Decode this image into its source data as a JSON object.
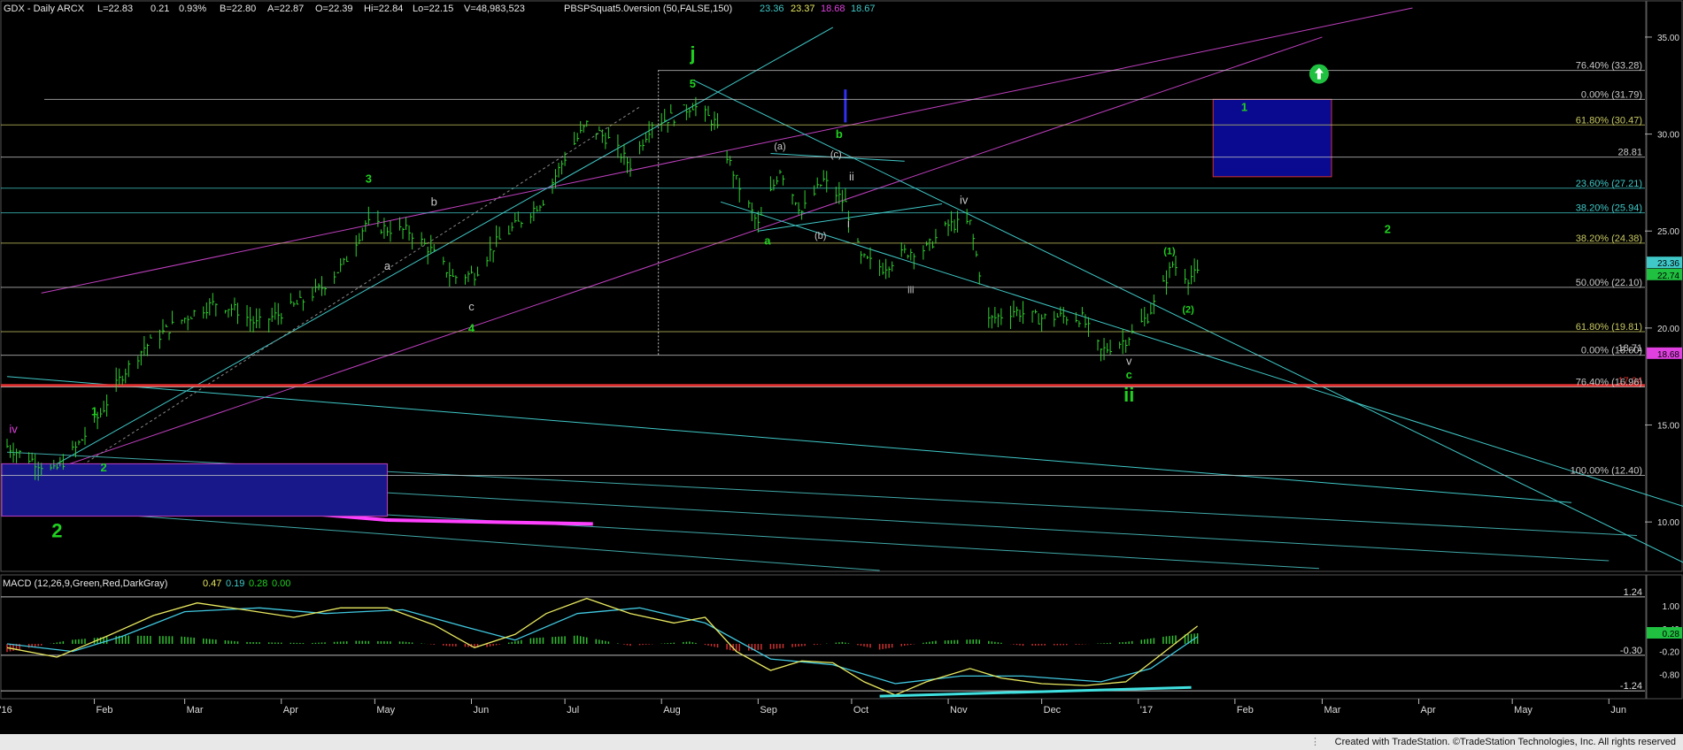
{
  "header": {
    "symbol": "GDX - Daily  ARCX",
    "last": "L=22.83",
    "change": "0.21",
    "change_pct": "0.93%",
    "bid": "B=22.80",
    "ask": "A=22.87",
    "open": "O=22.39",
    "high": "Hi=22.84",
    "low": "Lo=22.15",
    "volume": "V=48,983,523",
    "study": "PBSPSquat5.0version (50,FALSE,150)",
    "study_values": [
      "23.36",
      "23.37",
      "18.68",
      "18.67"
    ],
    "study_colors": [
      "#40c8c8",
      "#e8e860",
      "#e040e0",
      "#40c8c8"
    ]
  },
  "chart_data": {
    "type": "candlestick",
    "x_ticks": [
      "'16",
      "Feb",
      "Mar",
      "Apr",
      "May",
      "Jun",
      "Jul",
      "Aug",
      "Sep",
      "Oct",
      "Nov",
      "Dec",
      "'17",
      "Feb",
      "Mar",
      "Apr",
      "May",
      "Jun"
    ],
    "y_ticks": [
      "35.00",
      "30.00",
      "25.00",
      "20.00",
      "15.00",
      "10.00"
    ],
    "ylim": [
      7.5,
      36
    ],
    "price_path": [
      [
        "2016-01-04",
        13.9
      ],
      [
        "2016-01-12",
        13.2
      ],
      [
        "2016-01-19",
        12.6
      ],
      [
        "2016-01-26",
        13.8
      ],
      [
        "2016-02-03",
        15.6
      ],
      [
        "2016-02-10",
        17.6
      ],
      [
        "2016-02-17",
        19.0
      ],
      [
        "2016-02-25",
        20.0
      ],
      [
        "2016-03-04",
        20.8
      ],
      [
        "2016-03-11",
        21.3
      ],
      [
        "2016-03-18",
        20.9
      ],
      [
        "2016-03-24",
        20.2
      ],
      [
        "2016-03-31",
        20.7
      ],
      [
        "2016-04-07",
        21.3
      ],
      [
        "2016-04-14",
        22.1
      ],
      [
        "2016-04-21",
        23.3
      ],
      [
        "2016-04-28",
        25.4
      ],
      [
        "2016-05-05",
        25.1
      ],
      [
        "2016-05-12",
        25.0
      ],
      [
        "2016-05-19",
        24.0
      ],
      [
        "2016-05-26",
        22.6
      ],
      [
        "2016-06-02",
        22.8
      ],
      [
        "2016-06-09",
        24.4
      ],
      [
        "2016-06-16",
        25.4
      ],
      [
        "2016-06-24",
        26.6
      ],
      [
        "2016-07-01",
        28.8
      ],
      [
        "2016-07-08",
        30.5
      ],
      [
        "2016-07-15",
        29.7
      ],
      [
        "2016-07-22",
        28.4
      ],
      [
        "2016-07-29",
        30.6
      ],
      [
        "2016-08-05",
        30.9
      ],
      [
        "2016-08-11",
        31.5
      ],
      [
        "2016-08-18",
        30.6
      ],
      [
        "2016-08-25",
        27.6
      ],
      [
        "2016-09-01",
        25.3
      ],
      [
        "2016-09-08",
        28.2
      ],
      [
        "2016-09-15",
        26.0
      ],
      [
        "2016-09-22",
        27.6
      ],
      [
        "2016-09-29",
        26.4
      ],
      [
        "2016-10-04",
        23.6
      ],
      [
        "2016-10-11",
        23.1
      ],
      [
        "2016-10-18",
        23.9
      ],
      [
        "2016-10-25",
        24.1
      ],
      [
        "2016-11-01",
        25.3
      ],
      [
        "2016-11-08",
        25.4
      ],
      [
        "2016-11-14",
        20.4
      ],
      [
        "2016-11-22",
        20.9
      ],
      [
        "2016-11-30",
        20.5
      ],
      [
        "2016-12-07",
        20.6
      ],
      [
        "2016-12-14",
        20.5
      ],
      [
        "2016-12-20",
        18.8
      ],
      [
        "2016-12-28",
        19.4
      ],
      [
        "2017-01-04",
        20.6
      ],
      [
        "2017-01-09",
        22.2
      ],
      [
        "2017-01-12",
        23.3
      ],
      [
        "2017-01-17",
        22.6
      ],
      [
        "2017-01-20",
        22.8
      ]
    ],
    "price_labels": [
      {
        "value": "23.36",
        "bg": "#40c8c8",
        "fg": "#000"
      },
      {
        "value": "22.74",
        "bg": "#20c040",
        "fg": "#000"
      },
      {
        "value": "18.68",
        "bg": "#e040e0",
        "fg": "#000"
      }
    ],
    "fib_levels": [
      {
        "label": "76.40% (33.28)",
        "price": 33.28,
        "color": "#c8c8c8"
      },
      {
        "label": "0.00% (31.79)",
        "price": 31.79,
        "color": "#c8c8c8"
      },
      {
        "label": "61.80% (30.47)",
        "price": 30.47,
        "color": "#c8c864"
      },
      {
        "label": "28.81",
        "price": 28.81,
        "color": "#c8c8c8"
      },
      {
        "label": "23.60% (27.21)",
        "price": 27.21,
        "color": "#40c8c8"
      },
      {
        "label": "38.20% (25.94)",
        "price": 25.94,
        "color": "#40c8c8"
      },
      {
        "label": "38.20% (24.38)",
        "price": 24.38,
        "color": "#c8c864"
      },
      {
        "label": "50.00% (22.10)",
        "price": 22.1,
        "color": "#c8c8c8"
      },
      {
        "label": "61.80% (19.81)",
        "price": 19.81,
        "color": "#c8c864"
      },
      {
        "label": "0.00% (18.60)",
        "price": 18.6,
        "color": "#c8c8c8"
      },
      {
        "label": "18.71",
        "price": 18.71,
        "color": "#c8c8c8"
      },
      {
        "label": "17.04",
        "price": 17.04,
        "color": "#e03030"
      },
      {
        "label": "76.40% (16.96)",
        "price": 16.96,
        "color": "#c8c8c8"
      },
      {
        "label": "100.00% (12.40)",
        "price": 12.4,
        "color": "#c8c8c8"
      }
    ],
    "annotations": [
      {
        "text": "iv",
        "date": "2016-01-06",
        "price": 14.6,
        "color": "#e040e0"
      },
      {
        "text": "1",
        "date": "2016-02-01",
        "price": 15.5,
        "color": "#20d020"
      },
      {
        "text": "2",
        "date": "2016-02-04",
        "price": 12.6,
        "color": "#20d020"
      },
      {
        "text": "2",
        "date": "2016-01-20",
        "price": 9.2,
        "color": "#20d020"
      },
      {
        "text": "3",
        "date": "2016-04-29",
        "price": 27.5,
        "color": "#20d020"
      },
      {
        "text": "b",
        "date": "2016-05-20",
        "price": 26.3,
        "color": "#c8c8c8"
      },
      {
        "text": "a",
        "date": "2016-05-05",
        "price": 23.0,
        "color": "#c8c8c8"
      },
      {
        "text": "c",
        "date": "2016-06-01",
        "price": 20.9,
        "color": "#c8c8c8"
      },
      {
        "text": "4",
        "date": "2016-06-01",
        "price": 19.8,
        "color": "#20d020"
      },
      {
        "text": "j",
        "date": "2016-08-11",
        "price": 33.8,
        "color": "#20d020"
      },
      {
        "text": "5",
        "date": "2016-08-11",
        "price": 32.4,
        "color": "#20d020"
      },
      {
        "text": "(a)",
        "date": "2016-09-08",
        "price": 29.2,
        "color": "#c8c8c8"
      },
      {
        "text": "(c)",
        "date": "2016-09-26",
        "price": 28.8,
        "color": "#c8c8c8"
      },
      {
        "text": "b",
        "date": "2016-09-27",
        "price": 29.8,
        "color": "#20d020"
      },
      {
        "text": "ii",
        "date": "2016-10-01",
        "price": 27.6,
        "color": "#c8c8c8"
      },
      {
        "text": "i",
        "date": "2016-09-30",
        "price": 25.2,
        "color": "#c8c8c8"
      },
      {
        "text": "(b)",
        "date": "2016-09-21",
        "price": 24.6,
        "color": "#c8c8c8"
      },
      {
        "text": "a",
        "date": "2016-09-04",
        "price": 24.3,
        "color": "#20d020"
      },
      {
        "text": "iv",
        "date": "2016-11-06",
        "price": 26.4,
        "color": "#c8c8c8"
      },
      {
        "text": "iii",
        "date": "2016-10-20",
        "price": 21.8,
        "color": "#c8c8c8"
      },
      {
        "text": "v",
        "date": "2016-12-29",
        "price": 18.1,
        "color": "#c8c8c8"
      },
      {
        "text": "c",
        "date": "2016-12-29",
        "price": 17.4,
        "color": "#20d020"
      },
      {
        "text": "ii",
        "date": "2016-12-29",
        "price": 16.2,
        "color": "#20d020"
      },
      {
        "text": "(1)",
        "date": "2017-01-11",
        "price": 23.8,
        "color": "#20d020"
      },
      {
        "text": "(2)",
        "date": "2017-01-17",
        "price": 20.8,
        "color": "#20d020"
      },
      {
        "text": "1",
        "date": "2017-02-04",
        "price": 31.2,
        "color": "#20d020"
      },
      {
        "text": "2",
        "date": "2017-03-22",
        "price": 24.9,
        "color": "#20d020"
      }
    ],
    "macd": {
      "label": "MACD (12,26,9,Green,Red,DarkGray)",
      "values": [
        "0.47",
        "0.19",
        "0.28",
        "0.00"
      ],
      "value_colors": [
        "#e8e860",
        "#40c8c8",
        "#20d020",
        "#20d020"
      ],
      "y_ticks": [
        "1.00",
        "0.40",
        "-0.20",
        "-0.80"
      ],
      "ylim": [
        -1.4,
        1.4
      ],
      "levels": [
        {
          "label": "1.24",
          "value": 1.24
        },
        {
          "label": "-0.30",
          "value": -0.3
        },
        {
          "label": "-1.24",
          "value": -1.24
        }
      ],
      "current_label": "0.28",
      "macd_path": [
        [
          "2016-01-04",
          -0.1
        ],
        [
          "2016-01-20",
          -0.35
        ],
        [
          "2016-02-05",
          0.2
        ],
        [
          "2016-02-20",
          0.75
        ],
        [
          "2016-03-05",
          1.08
        ],
        [
          "2016-03-20",
          0.9
        ],
        [
          "2016-04-05",
          0.7
        ],
        [
          "2016-04-20",
          0.95
        ],
        [
          "2016-05-05",
          0.95
        ],
        [
          "2016-05-20",
          0.5
        ],
        [
          "2016-06-02",
          -0.1
        ],
        [
          "2016-06-15",
          0.25
        ],
        [
          "2016-06-25",
          0.8
        ],
        [
          "2016-07-08",
          1.2
        ],
        [
          "2016-07-22",
          0.8
        ],
        [
          "2016-08-05",
          0.55
        ],
        [
          "2016-08-15",
          0.7
        ],
        [
          "2016-08-25",
          -0.2
        ],
        [
          "2016-09-05",
          -0.7
        ],
        [
          "2016-09-15",
          -0.45
        ],
        [
          "2016-09-25",
          -0.5
        ],
        [
          "2016-10-05",
          -1.0
        ],
        [
          "2016-10-15",
          -1.35
        ],
        [
          "2016-10-25",
          -1.0
        ],
        [
          "2016-11-08",
          -0.65
        ],
        [
          "2016-11-18",
          -0.9
        ],
        [
          "2016-12-01",
          -1.05
        ],
        [
          "2016-12-15",
          -1.1
        ],
        [
          "2016-12-28",
          -1.0
        ],
        [
          "2017-01-08",
          -0.3
        ],
        [
          "2017-01-20",
          0.47
        ]
      ],
      "signal_path": [
        [
          "2016-01-04",
          0.0
        ],
        [
          "2016-01-25",
          -0.2
        ],
        [
          "2016-02-10",
          0.2
        ],
        [
          "2016-03-01",
          0.85
        ],
        [
          "2016-03-25",
          0.95
        ],
        [
          "2016-04-15",
          0.8
        ],
        [
          "2016-05-10",
          0.9
        ],
        [
          "2016-05-30",
          0.45
        ],
        [
          "2016-06-15",
          0.1
        ],
        [
          "2016-07-05",
          0.8
        ],
        [
          "2016-07-25",
          0.95
        ],
        [
          "2016-08-15",
          0.55
        ],
        [
          "2016-09-05",
          -0.4
        ],
        [
          "2016-09-25",
          -0.55
        ],
        [
          "2016-10-15",
          -1.05
        ],
        [
          "2016-11-05",
          -0.85
        ],
        [
          "2016-11-25",
          -0.85
        ],
        [
          "2016-12-20",
          -1.0
        ],
        [
          "2017-01-05",
          -0.65
        ],
        [
          "2017-01-20",
          0.19
        ]
      ],
      "support_line": [
        [
          "2016-10-10",
          -1.38
        ],
        [
          "2017-01-18",
          -1.15
        ]
      ],
      "histogram": [
        [
          "2016-01-10",
          -0.12
        ],
        [
          "2016-01-24",
          0.1
        ],
        [
          "2016-02-10",
          0.22
        ],
        [
          "2016-02-28",
          0.2
        ],
        [
          "2016-03-20",
          0.05
        ],
        [
          "2016-04-10",
          0.02
        ],
        [
          "2016-04-25",
          0.08
        ],
        [
          "2016-05-10",
          0.06
        ],
        [
          "2016-05-25",
          -0.06
        ],
        [
          "2016-06-05",
          -0.1
        ],
        [
          "2016-06-20",
          0.15
        ],
        [
          "2016-07-05",
          0.22
        ],
        [
          "2016-07-22",
          -0.05
        ],
        [
          "2016-08-10",
          0.06
        ],
        [
          "2016-08-25",
          -0.2
        ],
        [
          "2016-09-08",
          -0.12
        ],
        [
          "2016-09-28",
          0.05
        ],
        [
          "2016-10-10",
          -0.15
        ],
        [
          "2016-10-28",
          0.08
        ],
        [
          "2016-11-10",
          0.12
        ],
        [
          "2016-11-25",
          -0.05
        ],
        [
          "2016-12-10",
          -0.03
        ],
        [
          "2016-12-28",
          0.05
        ],
        [
          "2017-01-10",
          0.2
        ],
        [
          "2017-01-20",
          0.28
        ]
      ]
    }
  },
  "footer": {
    "credit": "Created with TradeStation. ©TradeStation Technologies, Inc. All rights reserved"
  }
}
